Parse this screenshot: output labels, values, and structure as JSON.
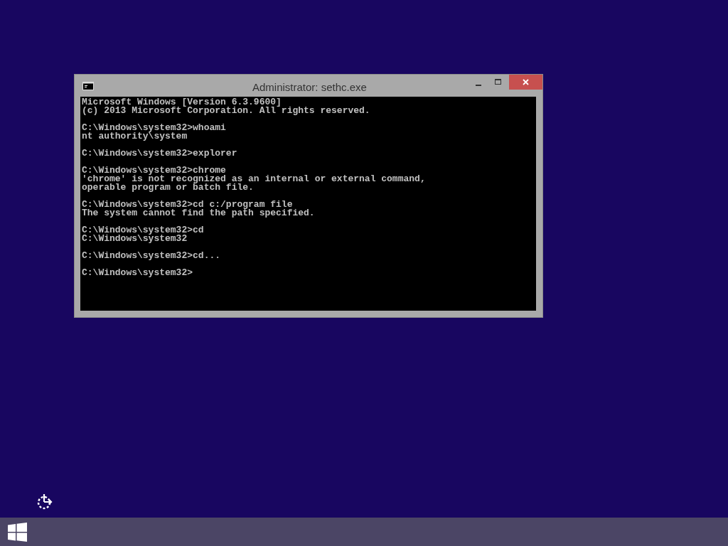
{
  "window": {
    "title": "Administrator: sethc.exe"
  },
  "console": {
    "blocks": [
      [
        "Microsoft Windows [Version 6.3.9600]",
        "(c) 2013 Microsoft Corporation. All rights reserved."
      ],
      [
        "C:\\Windows\\system32>whoami",
        "nt authority\\system"
      ],
      [
        "C:\\Windows\\system32>explorer"
      ],
      [
        "C:\\Windows\\system32>chrome",
        "'chrome' is not recognized as an internal or external command,",
        "operable program or batch file."
      ],
      [
        "C:\\Windows\\system32>cd c:/program file",
        "The system cannot find the path specified."
      ],
      [
        "C:\\Windows\\system32>cd",
        "C:\\Windows\\system32"
      ],
      [
        "C:\\Windows\\system32>cd..."
      ],
      [
        "C:\\Windows\\system32>"
      ]
    ]
  }
}
